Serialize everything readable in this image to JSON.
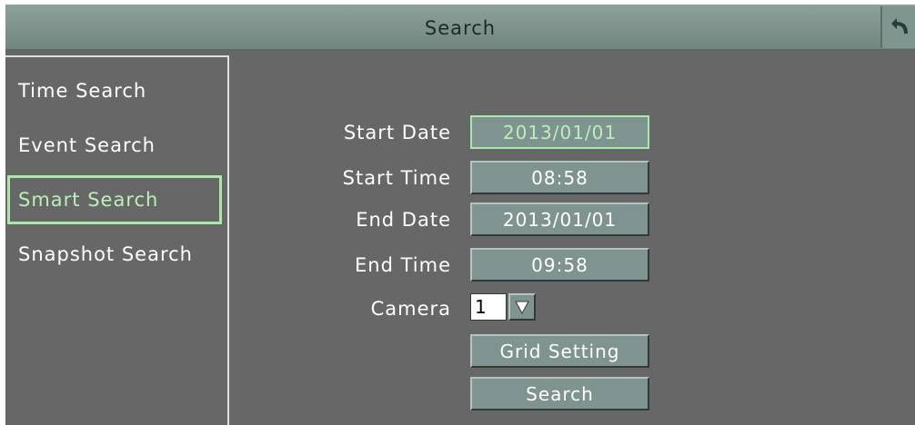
{
  "header": {
    "title": "Search",
    "back_icon": "back-arrow-icon"
  },
  "sidebar": {
    "items": [
      {
        "label": "Time Search"
      },
      {
        "label": "Event Search"
      },
      {
        "label": "Smart Search",
        "active": true
      },
      {
        "label": "Snapshot Search"
      }
    ]
  },
  "form": {
    "start_date": {
      "label": "Start Date",
      "value": "2013/01/01"
    },
    "start_time": {
      "label": "Start Time",
      "value": "08:58"
    },
    "end_date": {
      "label": "End Date",
      "value": "2013/01/01"
    },
    "end_time": {
      "label": "End Time",
      "value": "09:58"
    },
    "camera": {
      "label": "Camera",
      "value": "1"
    },
    "grid_setting_label": "Grid Setting",
    "search_label": "Search"
  },
  "colors": {
    "background": "#676767",
    "accent": "#a8e8a8",
    "button": "#7f9491",
    "titlebar": "#8ea09a"
  }
}
